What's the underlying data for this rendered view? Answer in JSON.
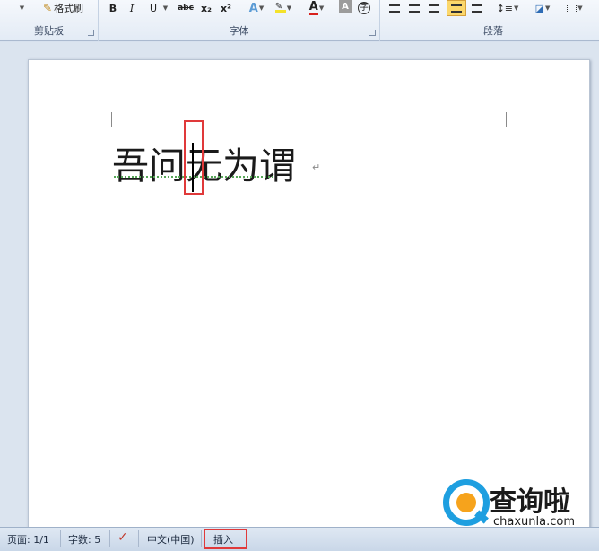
{
  "ribbon": {
    "clipboard": {
      "format_painter_label": "格式刷",
      "group_label": "剪贴板"
    },
    "font": {
      "group_label": "字体",
      "bold": "B",
      "italic": "I",
      "underline": "U",
      "strike": "abc",
      "subscript": "x₂",
      "superscript": "x²"
    },
    "paragraph": {
      "group_label": "段落"
    }
  },
  "document": {
    "text": "吾问无为谓",
    "paragraph_mark": "↵"
  },
  "status_bar": {
    "page": "页面: 1/1",
    "word_count": "字数: 5",
    "language": "中文(中国)",
    "mode": "插入"
  },
  "watermark": {
    "title": "查询啦",
    "url": "chaxunla.com"
  },
  "colors": {
    "highlight_box": "#e0393a",
    "watermark_blue": "#1e9fe0",
    "watermark_orange": "#f6a31c"
  }
}
